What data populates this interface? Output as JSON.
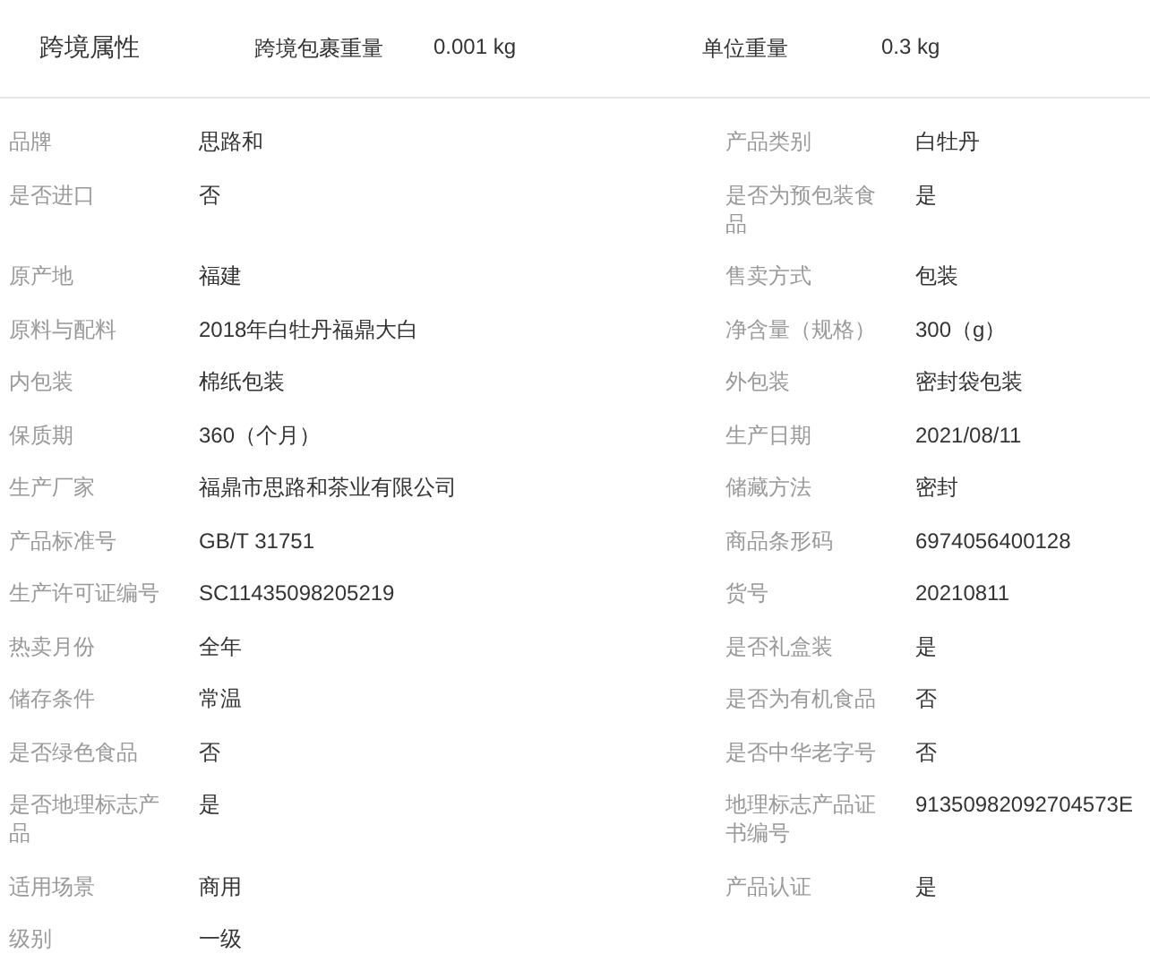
{
  "header": {
    "title": "跨境属性",
    "fields": [
      {
        "label": "跨境包裹重量",
        "value": "0.001 kg"
      },
      {
        "label": "单位重量",
        "value": "0.3 kg"
      }
    ]
  },
  "attributes": [
    {
      "label": "品牌",
      "value": "思路和"
    },
    {
      "label": "产品类别",
      "value": "白牡丹"
    },
    {
      "label": "是否进口",
      "value": "否"
    },
    {
      "label": "是否为预包装食品",
      "value": "是"
    },
    {
      "label": "原产地",
      "value": "福建"
    },
    {
      "label": "售卖方式",
      "value": "包装"
    },
    {
      "label": "原料与配料",
      "value": "2018年白牡丹福鼎大白"
    },
    {
      "label": "净含量（规格）",
      "value": "300（g）"
    },
    {
      "label": "内包装",
      "value": "棉纸包装"
    },
    {
      "label": "外包装",
      "value": "密封袋包装"
    },
    {
      "label": "保质期",
      "value": "360（个月）"
    },
    {
      "label": "生产日期",
      "value": "2021/08/11"
    },
    {
      "label": "生产厂家",
      "value": "福鼎市思路和茶业有限公司"
    },
    {
      "label": "储藏方法",
      "value": "密封"
    },
    {
      "label": "产品标准号",
      "value": "GB/T 31751"
    },
    {
      "label": "商品条形码",
      "value": "6974056400128"
    },
    {
      "label": "生产许可证编号",
      "value": "SC11435098205219"
    },
    {
      "label": "货号",
      "value": "20210811"
    },
    {
      "label": "热卖月份",
      "value": "全年"
    },
    {
      "label": "是否礼盒装",
      "value": "是"
    },
    {
      "label": "储存条件",
      "value": "常温"
    },
    {
      "label": "是否为有机食品",
      "value": "否"
    },
    {
      "label": "是否绿色食品",
      "value": "否"
    },
    {
      "label": "是否中华老字号",
      "value": "否"
    },
    {
      "label": "是否地理标志产品",
      "value": "是"
    },
    {
      "label": "地理标志产品证书编号",
      "value": "91350982092704573E"
    },
    {
      "label": "适用场景",
      "value": "商用"
    },
    {
      "label": "产品认证",
      "value": "是"
    },
    {
      "label": "级别",
      "value": "一级"
    }
  ]
}
